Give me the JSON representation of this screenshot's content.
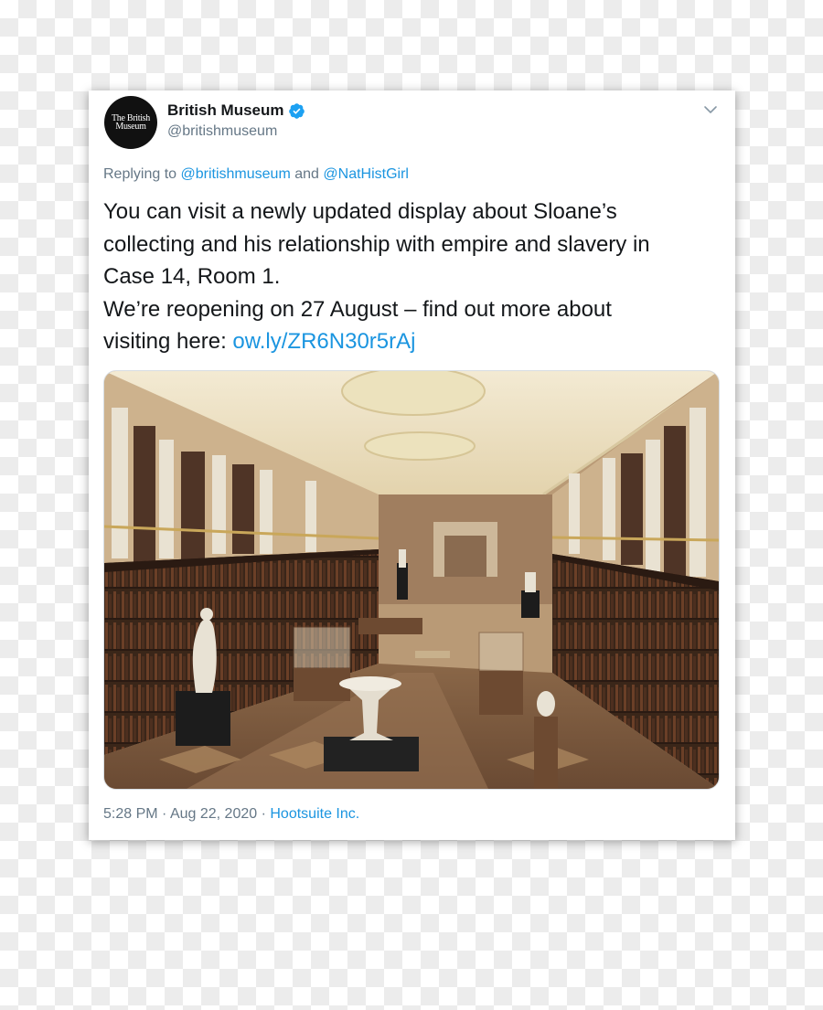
{
  "account": {
    "name": "British Museum",
    "handle": "@britishmuseum",
    "avatar_text_line1": "The British",
    "avatar_text_line2": "Museum",
    "verified_icon": "verified-badge-icon"
  },
  "reply": {
    "prefix": "Replying to",
    "mention1": "@britishmuseum",
    "conjunction": "and",
    "mention2": "@NatHistGirl"
  },
  "tweet": {
    "line1": "You can visit a newly updated display about Sloane’s",
    "line2": "collecting and his relationship with empire and slavery in",
    "line3": "Case 14, Room 1.",
    "line4": "We’re reopening on 27 August – find out more about",
    "line5_prefix": "visiting here:",
    "link": "ow.ly/ZR6N30r5rAj"
  },
  "meta": {
    "time": "5:28 PM",
    "separator": "·",
    "date": "Aug 22, 2020",
    "source": "Hootsuite Inc."
  },
  "colors": {
    "link": "#1b95e0",
    "verified": "#1da1f2",
    "text": "#14171a",
    "secondary": "#657786"
  }
}
